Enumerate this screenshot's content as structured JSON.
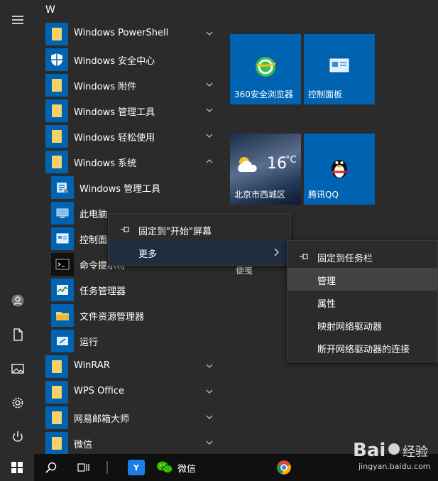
{
  "rail": {
    "icons": [
      "hamburger-icon",
      "user-icon",
      "document-icon",
      "pictures-icon",
      "settings-icon",
      "power-icon"
    ]
  },
  "applist": {
    "section_letter": "W",
    "items": [
      {
        "label": "Windows PowerShell",
        "icon": "folder-icon",
        "expandable": true
      },
      {
        "label": "Windows 安全中心",
        "icon": "shield-icon",
        "expandable": false
      },
      {
        "label": "Windows 附件",
        "icon": "folder-icon",
        "expandable": true
      },
      {
        "label": "Windows 管理工具",
        "icon": "folder-icon",
        "expandable": true
      },
      {
        "label": "Windows 轻松使用",
        "icon": "folder-icon",
        "expandable": true
      },
      {
        "label": "Windows 系统",
        "icon": "folder-icon",
        "expandable": true,
        "expanded": true
      },
      {
        "label": "Windows 管理工具",
        "icon": "admin-tools-icon",
        "sub": true
      },
      {
        "label": "此电脑",
        "icon": "computer-icon",
        "sub": true
      },
      {
        "label": "控制面板",
        "icon": "control-panel-icon",
        "sub": true
      },
      {
        "label": "命令提示符",
        "icon": "cmd-icon",
        "sub": true
      },
      {
        "label": "任务管理器",
        "icon": "task-manager-icon",
        "sub": true
      },
      {
        "label": "文件资源管理器",
        "icon": "explorer-icon",
        "sub": true
      },
      {
        "label": "运行",
        "icon": "run-icon",
        "sub": true
      },
      {
        "label": "WinRAR",
        "icon": "folder-icon",
        "expandable": true
      },
      {
        "label": "WPS Office",
        "icon": "folder-icon",
        "expandable": true
      },
      {
        "label": "网易邮箱大师",
        "icon": "folder-icon",
        "expandable": true
      },
      {
        "label": "微信",
        "icon": "folder-icon",
        "expandable": true
      }
    ]
  },
  "tiles": {
    "browser": "360安全浏览器",
    "control_panel": "控制面板",
    "weather_temp": "16",
    "weather_unit": "°C",
    "weather_city": "北京市西城区",
    "qq": "腾讯QQ",
    "hidden_label": "便笺"
  },
  "menu1": {
    "pin_start": "固定到\"开始\"屏幕",
    "more": "更多"
  },
  "menu2": {
    "pin_taskbar": "固定到任务栏",
    "manage": "管理",
    "properties": "属性",
    "map_drive": "映射网络驱动器",
    "disconnect_drive": "断开网络驱动器的连接"
  },
  "taskbar": {
    "wechat": "微信"
  },
  "colors": {
    "accent": "#0063b1",
    "folder": "#f6d167",
    "panel": "#2b2b2b",
    "taskbar": "#101010"
  },
  "watermark": "Bai 经验 jingyan.baidu.com"
}
